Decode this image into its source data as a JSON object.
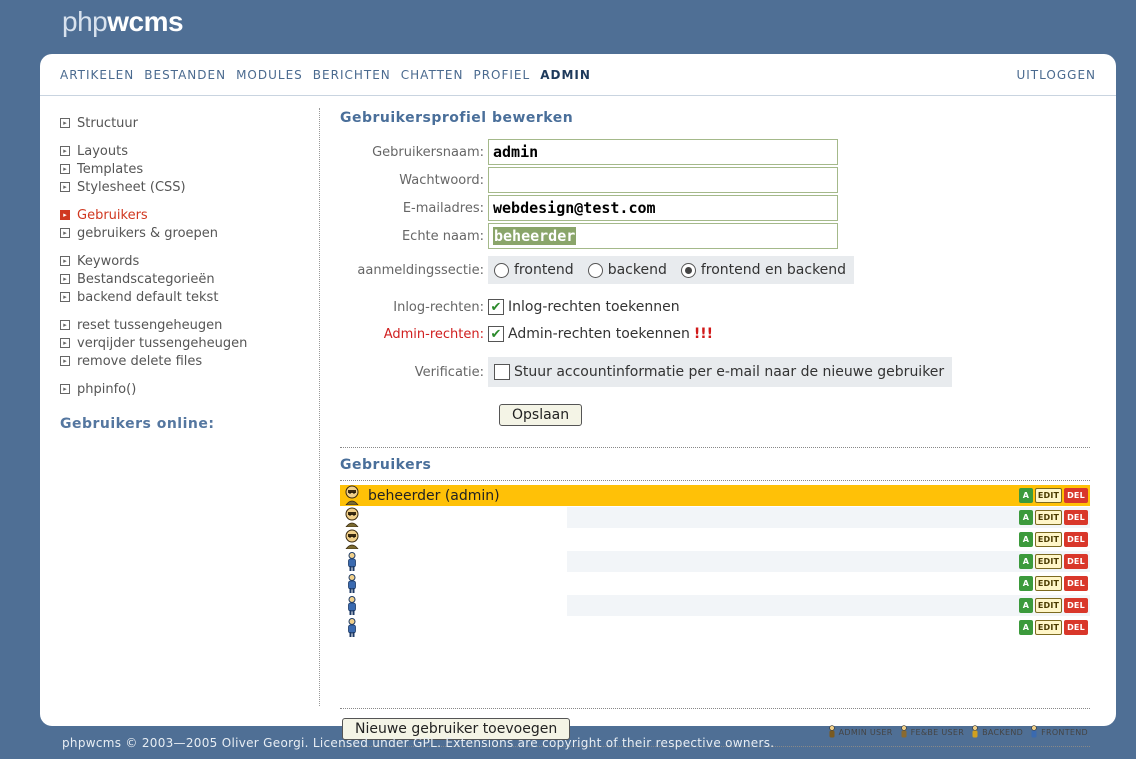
{
  "brand": {
    "prefix": "php",
    "suffix": "wcms"
  },
  "topnav": {
    "items": [
      "ARTIKELEN",
      "BESTANDEN",
      "MODULES",
      "BERICHTEN",
      "CHATTEN",
      "PROFIEL",
      "ADMIN"
    ],
    "active": "ADMIN",
    "logout": "UITLOGGEN"
  },
  "sidebar": {
    "groups": [
      [
        "Structuur"
      ],
      [
        "Layouts",
        "Templates",
        "Stylesheet (CSS)"
      ],
      [
        "Gebruikers",
        "gebruikers & groepen"
      ],
      [
        "Keywords",
        "Bestandscategorieën",
        "backend default tekst"
      ],
      [
        "reset tussengeheugen",
        "verqijder tussengeheugen",
        "remove delete files"
      ],
      [
        "phpinfo()"
      ]
    ],
    "active": "Gebruikers",
    "online_title": "Gebruikers online:"
  },
  "form": {
    "title": "Gebruikersprofiel bewerken",
    "username_label": "Gebruikersnaam:",
    "username_value": "admin",
    "password_label": "Wachtwoord:",
    "password_value": "",
    "email_label": "E-mailadres:",
    "email_value": "webdesign@test.com",
    "realname_label": "Echte naam:",
    "realname_value": "beheerder",
    "section_label": "aanmeldingssectie:",
    "section_options": [
      "frontend",
      "backend",
      "frontend en backend"
    ],
    "section_selected": "frontend en backend",
    "login_label": "Inlog-rechten:",
    "login_text": "Inlog-rechten toekennen",
    "login_checked": true,
    "admin_label": "Admin-rechten:",
    "admin_text": "Admin-rechten toekennen",
    "admin_warning": "!!!",
    "admin_checked": true,
    "verify_label": "Verificatie:",
    "verify_text": "Stuur accountinformatie per e-mail naar de nieuwe gebruiker",
    "verify_checked": false,
    "save_label": "Opslaan"
  },
  "users": {
    "title": "Gebruikers",
    "rows": [
      {
        "name": "beheerder (admin)",
        "type": "admin",
        "highlight": true
      },
      {
        "name": "",
        "type": "admin"
      },
      {
        "name": "",
        "type": "admin"
      },
      {
        "name": "",
        "type": "frontend"
      },
      {
        "name": "",
        "type": "frontend"
      },
      {
        "name": "",
        "type": "frontend"
      },
      {
        "name": "",
        "type": "frontend"
      }
    ],
    "actions": {
      "a": "A",
      "edit": "EDIT",
      "del": "DEL"
    },
    "add_button": "Nieuwe gebruiker toevoegen",
    "legend": [
      {
        "label": "ADMIN USER",
        "icon": "admin-user-icon",
        "color": "#7a5a20"
      },
      {
        "label": "FE&BE USER",
        "icon": "febe-user-icon",
        "color": "#8a6a30"
      },
      {
        "label": "BACKEND",
        "icon": "backend-user-icon",
        "color": "#d0a020"
      },
      {
        "label": "FRONTEND",
        "icon": "frontend-user-icon",
        "color": "#3a6ab0"
      }
    ]
  },
  "footer": "phpwcms © 2003—2005 Oliver Georgi. Licensed under GPL. Extensions are copyright of their respective owners."
}
